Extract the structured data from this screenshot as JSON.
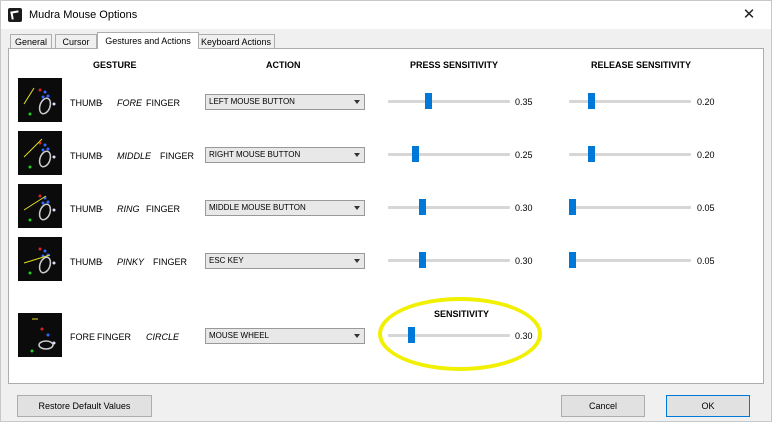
{
  "window": {
    "title": "Mudra Mouse Options",
    "close_glyph": "✕"
  },
  "tabs": [
    {
      "label": "General",
      "active": false
    },
    {
      "label": "Cursor",
      "active": false
    },
    {
      "label": "Gestures and Actions",
      "active": true
    },
    {
      "label": "Keyboard Actions",
      "active": false
    }
  ],
  "headers": {
    "gesture": "GESTURE",
    "action": "ACTION",
    "press": "PRESS SENSITIVITY",
    "release": "RELEASE SENSITIVITY",
    "sensitivity": "SENSITIVITY"
  },
  "rows": [
    {
      "label_a": "THUMB",
      "dash": "-",
      "label_b": "FORE",
      "label_c": "FINGER",
      "action": "LEFT MOUSE BUTTON",
      "press": "0.35",
      "release": "0.20"
    },
    {
      "label_a": "THUMB",
      "dash": "-",
      "label_b": "MIDDLE",
      "label_c": "FINGER",
      "action": "RIGHT MOUSE BUTTON",
      "press": "0.25",
      "release": "0.20"
    },
    {
      "label_a": "THUMB",
      "dash": "-",
      "label_b": "RING",
      "label_c": "FINGER",
      "action": "MIDDLE MOUSE BUTTON",
      "press": "0.30",
      "release": "0.05"
    },
    {
      "label_a": "THUMB",
      "dash": "-",
      "label_b": "PINKY",
      "label_c": "FINGER",
      "action": "ESC KEY",
      "press": "0.30",
      "release": "0.05"
    }
  ],
  "circle_row": {
    "label_a": "FORE",
    "label_b": "FINGER",
    "label_c": "CIRCLE",
    "action": "MOUSE WHEEL",
    "sensitivity": "0.30"
  },
  "buttons": {
    "restore": "Restore Default Values",
    "cancel": "Cancel",
    "ok": "OK"
  },
  "colors": {
    "accent": "#0078d7",
    "highlight": "#f0f000"
  },
  "icons": {
    "app": "mudra-app-icon",
    "close": "close-icon",
    "dropdown": "chevron-down-icon"
  }
}
